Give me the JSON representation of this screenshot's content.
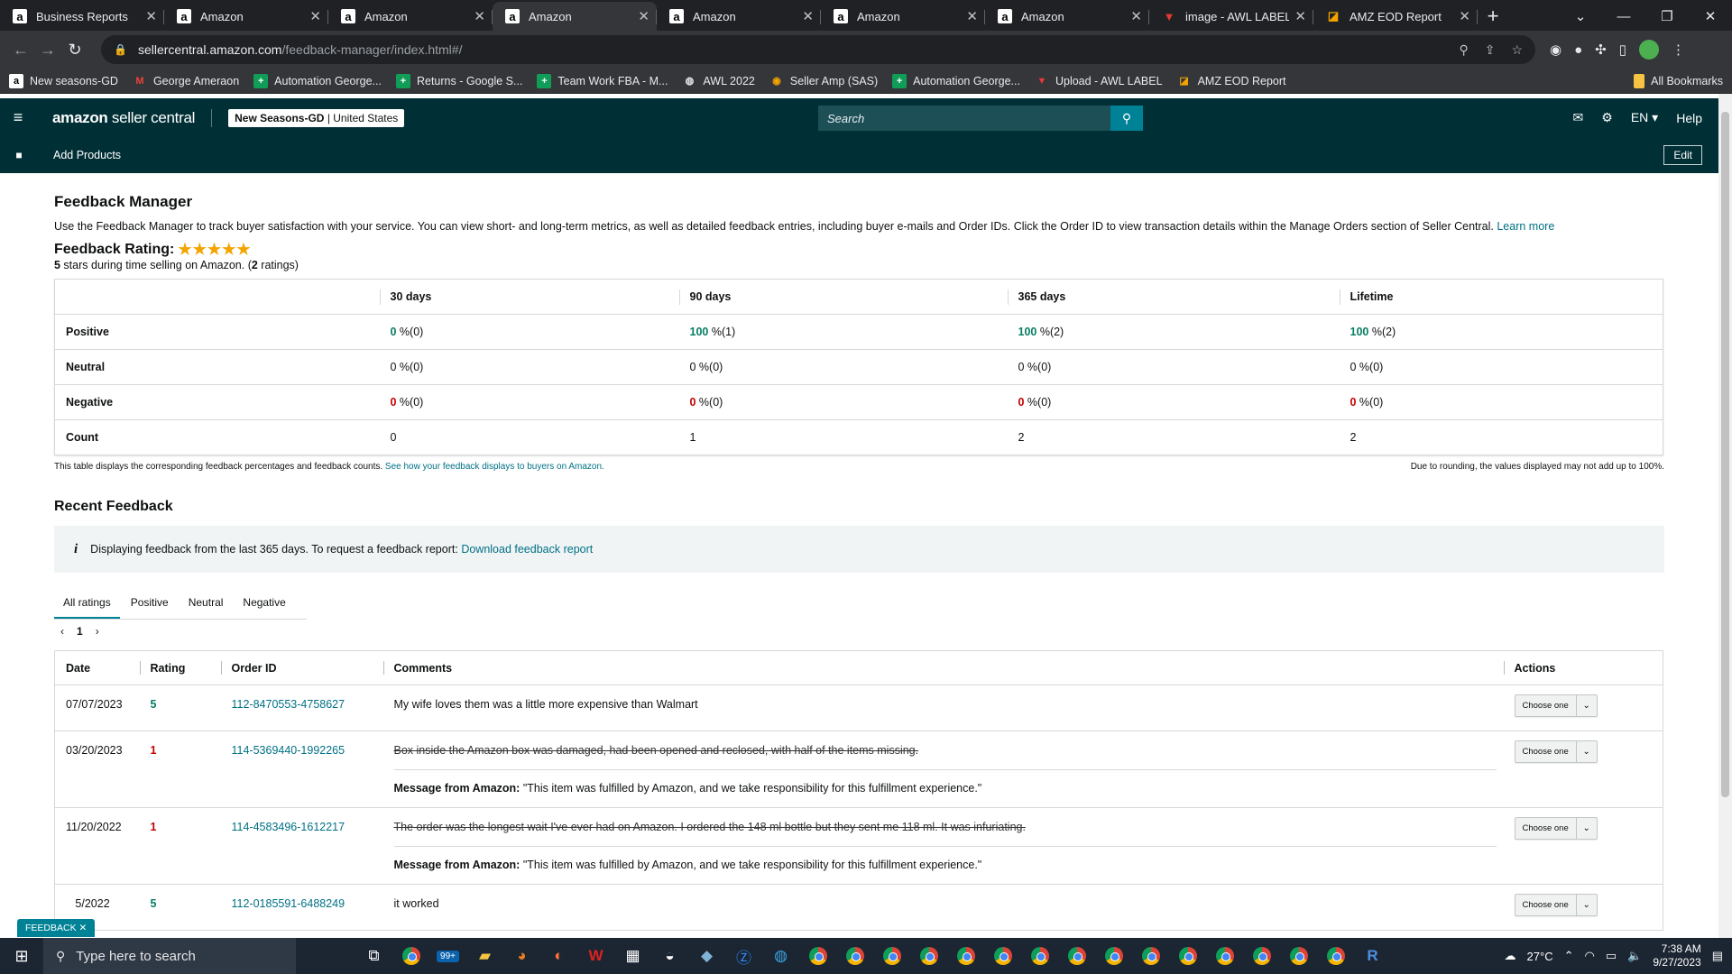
{
  "browser": {
    "tabs": [
      {
        "title": "Business Reports",
        "icon": "amazon-a"
      },
      {
        "title": "Amazon",
        "icon": "amazon-a"
      },
      {
        "title": "Amazon",
        "icon": "amazon-a"
      },
      {
        "title": "Amazon",
        "icon": "amazon-a",
        "active": true
      },
      {
        "title": "Amazon",
        "icon": "amazon-a"
      },
      {
        "title": "Amazon",
        "icon": "amazon-a"
      },
      {
        "title": "Amazon",
        "icon": "amazon-a"
      },
      {
        "title": "image - AWL LABEL",
        "icon": "awl-label"
      },
      {
        "title": "AMZ EOD Report",
        "icon": "eod-report"
      }
    ],
    "url_host": "sellercentral.amazon.com",
    "url_path": "/feedback-manager/index.html#/",
    "bookmarks": [
      "New seasons-GD",
      "George Ameraon",
      "Automation George...",
      "Returns - Google S...",
      "Team Work FBA - M...",
      "AWL 2022",
      "Seller Amp (SAS)",
      "Automation George...",
      "Upload - AWL LABEL",
      "AMZ EOD Report"
    ],
    "all_bookmarks": "All Bookmarks"
  },
  "header": {
    "logo_bold": "amazon",
    "logo_rest": " seller central",
    "account_store": "New Seasons-GD",
    "account_region": " | United States",
    "search_placeholder": "Search",
    "language": "EN",
    "help": "Help",
    "add_products": "Add Products",
    "edit": "Edit"
  },
  "page": {
    "title": "Feedback Manager",
    "description": "Use the Feedback Manager to track buyer satisfaction with your service. You can view short- and long-term metrics, as well as detailed feedback entries, including buyer e-mails and Order IDs. Click the Order ID to view transaction details within the Manage Orders section of Seller Central.",
    "learn_more": "Learn more",
    "rating_label": "Feedback Rating:",
    "rating_stars": 5,
    "rating_sub_prefix": "5",
    "rating_sub_middle": " stars during time selling on Amazon. (",
    "rating_sub_count": "2",
    "rating_sub_suffix": " ratings)"
  },
  "summary": {
    "columns": [
      "30 days",
      "90 days",
      "365 days",
      "Lifetime"
    ],
    "rows": [
      {
        "label": "Positive",
        "kind": "g",
        "cells": [
          [
            "0",
            " %(0)"
          ],
          [
            "100",
            " %(1)"
          ],
          [
            "100",
            " %(2)"
          ],
          [
            "100",
            " %(2)"
          ]
        ]
      },
      {
        "label": "Neutral",
        "kind": "",
        "cells": [
          [
            "0",
            " %(0)"
          ],
          [
            "0",
            " %(0)"
          ],
          [
            "0",
            " %(0)"
          ],
          [
            "0",
            " %(0)"
          ]
        ]
      },
      {
        "label": "Negative",
        "kind": "r",
        "cells": [
          [
            "0",
            " %(0)"
          ],
          [
            "0",
            " %(0)"
          ],
          [
            "0",
            " %(0)"
          ],
          [
            "0",
            " %(0)"
          ]
        ]
      },
      {
        "label": "Count",
        "kind": "",
        "cells": [
          [
            "",
            "0"
          ],
          [
            "",
            "1"
          ],
          [
            "",
            "2"
          ],
          [
            "",
            "2"
          ]
        ]
      }
    ],
    "note_left": "This table displays the corresponding feedback percentages and feedback counts.",
    "note_link": "See how your feedback displays to buyers on Amazon.",
    "note_right": "Due to rounding, the values displayed may not add up to 100%."
  },
  "recent": {
    "title": "Recent Feedback",
    "info_text": "Displaying feedback from the last 365 days. To request a feedback report:",
    "info_link": "Download feedback report",
    "tabs": [
      "All ratings",
      "Positive",
      "Neutral",
      "Negative"
    ],
    "page": "1",
    "headers": [
      "Date",
      "Rating",
      "Order ID",
      "Comments",
      "Actions"
    ],
    "rows": [
      {
        "date": "07/07/2023",
        "rating": "5",
        "kind": "g",
        "order": "112-8470553-4758627",
        "comment": "My wife loves them was a little more expensive than Walmart",
        "struck": false,
        "message": ""
      },
      {
        "date": "03/20/2023",
        "rating": "1",
        "kind": "r",
        "order": "114-5369440-1992265",
        "comment": "Box inside the Amazon box was damaged, had been opened and reclosed, with half of the items missing.",
        "struck": true,
        "message": "\"This item was fulfilled by Amazon, and we take responsibility for this fulfillment experience.\""
      },
      {
        "date": "11/20/2022",
        "rating": "1",
        "kind": "r",
        "order": "114-4583496-1612217",
        "comment": "The order was the longest wait I've ever had on Amazon. I ordered the 148 ml bottle but they sent me 118 ml. It was infuriating.",
        "struck": true,
        "message": "\"This item was fulfilled by Amazon, and we take responsibility for this fulfillment experience.\""
      },
      {
        "date": "   5/2022",
        "rating": "5",
        "kind": "g",
        "order": "112-0185591-6488249",
        "comment": "it worked",
        "struck": false,
        "message": ""
      }
    ],
    "message_label": "Message from Amazon:",
    "choose_label": "Choose one"
  },
  "feedback_badge": "FEEDBACK",
  "taskbar": {
    "search_placeholder": "Type here to search",
    "mail_badge": "99+",
    "weather": "27°C",
    "time": "7:38 AM",
    "date": "9/27/2023"
  },
  "colors": {
    "header_bg": "#002f36",
    "link": "#007185",
    "positive": "#067d62",
    "negative": "#c40000",
    "accent": "#008296"
  }
}
